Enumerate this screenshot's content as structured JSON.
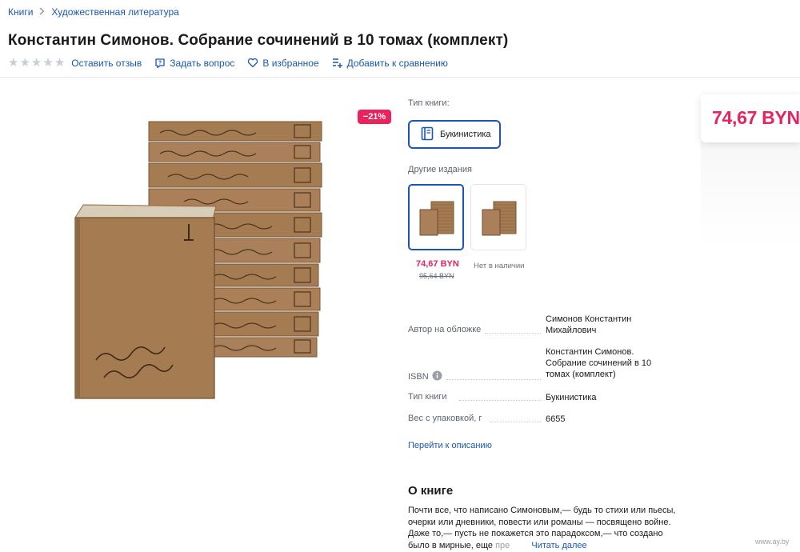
{
  "breadcrumb": {
    "items": [
      "Книги",
      "Художественная литература"
    ]
  },
  "product": {
    "title": "Константин Симонов. Собрание сочинений в 10 томах (комплект)",
    "discount_badge": "−21%",
    "price": "74,67 BYN"
  },
  "actions": {
    "rating_stars": 5,
    "rating_filled": 0,
    "review": "Оставить отзыв",
    "question": "Задать вопрос",
    "favorite": "В избранное",
    "compare": "Добавить к сравнению"
  },
  "book_type": {
    "label": "Тип книги:",
    "option": "Букинистика"
  },
  "editions": {
    "label": "Другие издания",
    "items": [
      {
        "price": "74,67 BYN",
        "old_price": "95,64 BYN",
        "selected": true
      },
      {
        "status": "Нет в наличии",
        "selected": false
      }
    ]
  },
  "specs": [
    {
      "name": "Автор на обложке",
      "value": "Симонов Константин Михайлович"
    },
    {
      "name": "ISBN",
      "value": "Константин Симонов. Собрание сочинений в 10 томах (комплект)"
    },
    {
      "name": "Тип книги",
      "value": "Букинистика"
    },
    {
      "name": "Вес с упаковкой, г",
      "value": "6655"
    }
  ],
  "goto_description": "Перейти к описанию",
  "about": {
    "heading": "О книге",
    "text": "Почти все, что написано Симоновым,— будь то стихи или пьесы, очерки или дневники, повести или романы — посвящено войне. Даже то,— пусть не покажется это парадоксом,— что создано было в мирные, еще",
    "faded": "пре",
    "read_more": "Читать далее"
  },
  "watermark": "www.ay.by",
  "colors": {
    "accent": "#1a56b6",
    "price": "#e8235d",
    "book_cover": "#a57b52"
  }
}
